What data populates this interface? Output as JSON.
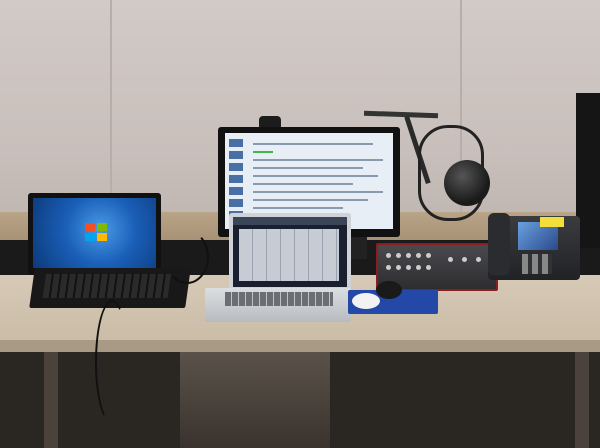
{
  "scene": {
    "objects": [
      "wall",
      "desk",
      "laptop-left",
      "monitor",
      "laptop-right",
      "mixer",
      "desk-phone",
      "microphone",
      "mouse",
      "mousepad",
      "webcam"
    ]
  },
  "colors": {
    "wall": "#cbc2be",
    "desk": "#d2c4af",
    "mixer_trim": "#8a1d1d",
    "mousepad": "#2448a8",
    "win_desktop": "#1a5fb8"
  }
}
